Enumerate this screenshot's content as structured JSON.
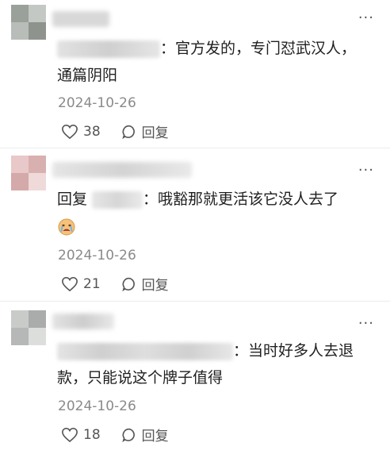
{
  "comments": [
    {
      "text": "：官方发的，专门怼武汉人，通篇阴阳",
      "text_line1": "：官方发的，专门怼武汉人，",
      "text_line2": "通篇阴阳",
      "date": "2024-10-26",
      "likes": "38",
      "reply_label": "回复",
      "more": "···"
    },
    {
      "reply_prefix": "回复",
      "text": "：哦豁那就更活该它没人去了",
      "emoji": "crying-emoji",
      "date": "2024-10-26",
      "likes": "21",
      "reply_label": "回复",
      "more": "···"
    },
    {
      "text": "：当时好多人去退款，只能说这个牌子值得",
      "text_line1": "：当时好多人去退",
      "text_line2": "款，只能说这个牌子值得",
      "date": "2024-10-26",
      "likes": "18",
      "reply_label": "回复",
      "more": "···"
    }
  ],
  "colors": {
    "date": "#8a8a8a",
    "text": "#1f1f1f",
    "divider": "#ececec"
  }
}
